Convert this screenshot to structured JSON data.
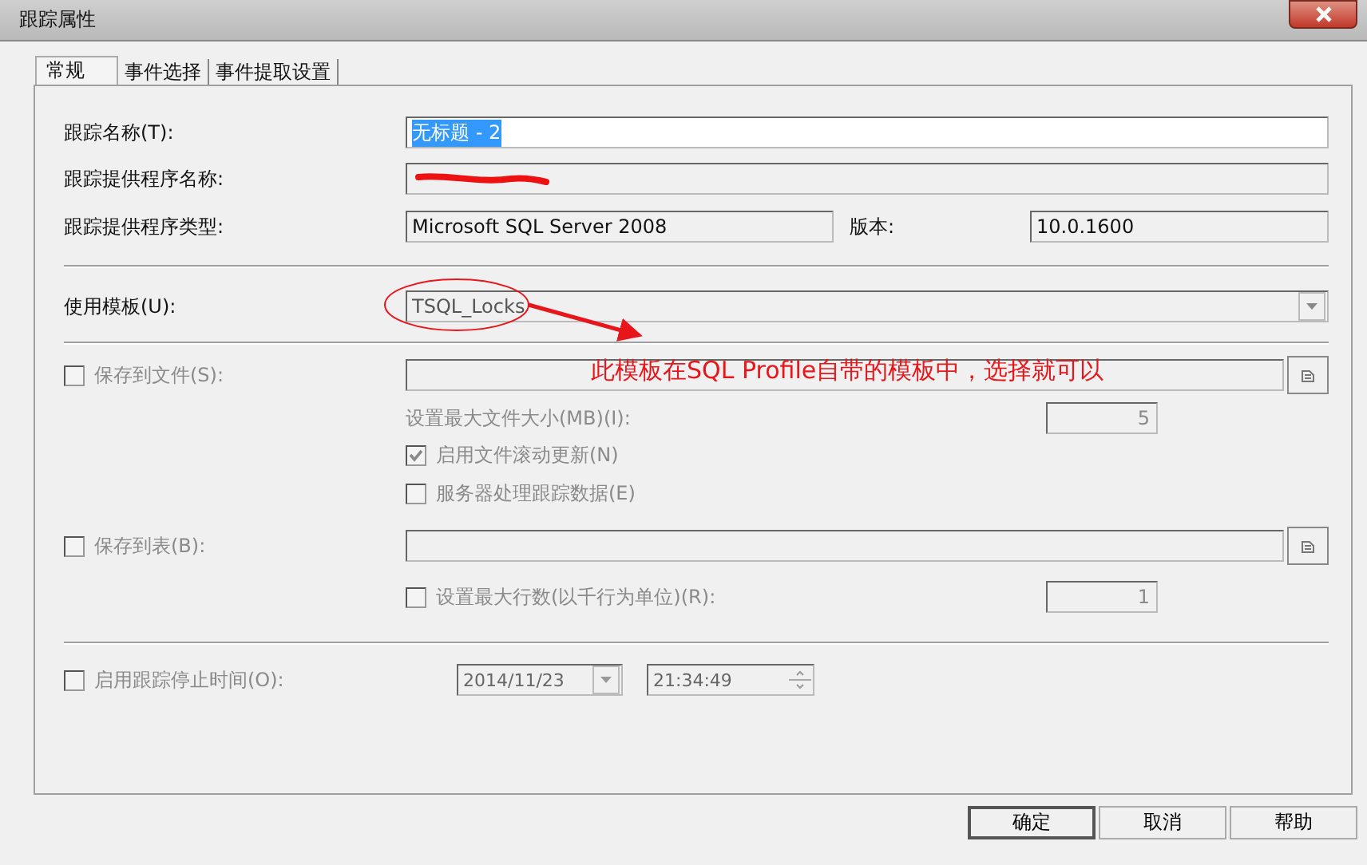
{
  "window": {
    "title": "跟踪属性"
  },
  "tabs": [
    {
      "label": "常规",
      "selected": true
    },
    {
      "label": "事件选择",
      "selected": false
    },
    {
      "label": "事件提取设置",
      "selected": false
    }
  ],
  "trace_name": {
    "label": "跟踪名称(T):",
    "value": "无标题 - 2",
    "text_selected": true
  },
  "provider_name": {
    "label": "跟踪提供程序名称:",
    "redacted": true
  },
  "provider_type": {
    "label": "跟踪提供程序类型:",
    "value": "Microsoft SQL Server 2008"
  },
  "version": {
    "label": "版本:",
    "value": "10.0.1600"
  },
  "template": {
    "label": "使用模板(U):",
    "value": "TSQL_Locks"
  },
  "save_to_file": {
    "label": "保存到文件(S):",
    "checked": false,
    "disabled": true
  },
  "max_file_size": {
    "label": "设置最大文件大小(MB)(I):",
    "value": "5",
    "disabled": true
  },
  "file_rollover": {
    "label": "启用文件滚动更新(N)",
    "checked": true,
    "disabled": true
  },
  "server_processes": {
    "label": "服务器处理跟踪数据(E)",
    "checked": false,
    "disabled": true
  },
  "save_to_table": {
    "label": "保存到表(B):",
    "checked": false,
    "disabled": true
  },
  "max_rows": {
    "label": "设置最大行数(以千行为单位)(R):",
    "checked": false,
    "value": "1",
    "disabled": true
  },
  "stop_time": {
    "label": "启用跟踪停止时间(O):",
    "checked": false,
    "date": "2014/11/23",
    "time": "21:34:49",
    "disabled": true
  },
  "annotation": {
    "text": "此模板在SQL Profile自带的模板中，选择就可以"
  },
  "buttons": [
    {
      "label": "确定",
      "default": true
    },
    {
      "label": "取消",
      "default": false
    },
    {
      "label": "帮助",
      "default": false
    }
  ]
}
